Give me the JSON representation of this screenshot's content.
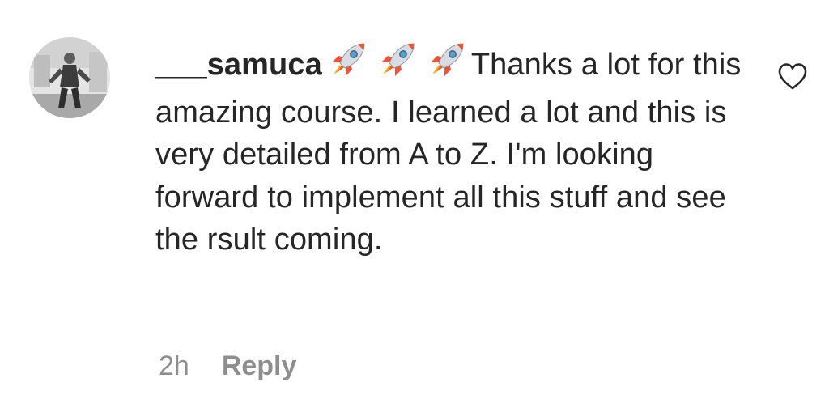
{
  "comment": {
    "username": "___samuca",
    "emoji": [
      "rocket",
      "rocket",
      "rocket"
    ],
    "text": "Thanks a lot for this amazing course. I learned a lot and this is very detailed from A to Z. I'm looking forward to implement all this stuff and see the rsult coming.",
    "time": "2h",
    "reply_label": "Reply",
    "like_icon": "heart-outline-icon"
  }
}
